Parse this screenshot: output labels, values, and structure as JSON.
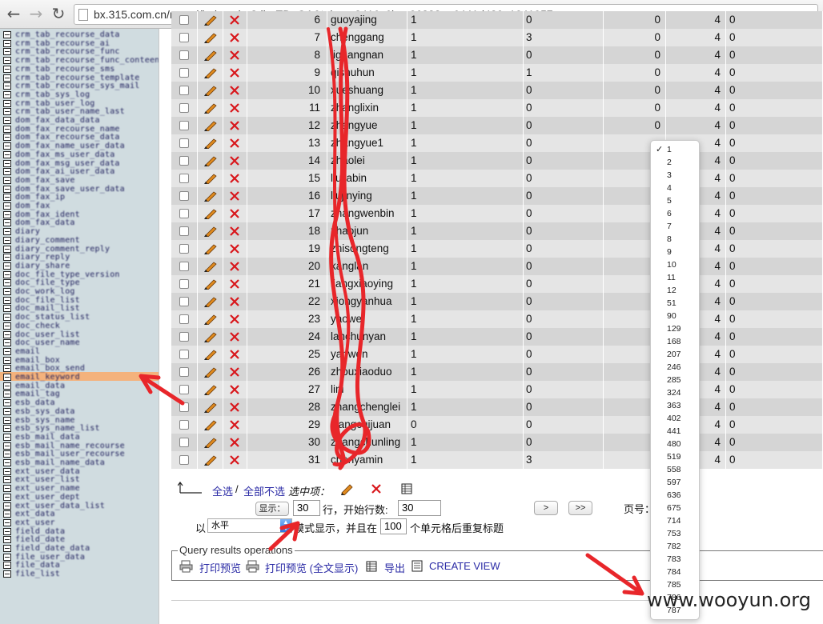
{
  "browser": {
    "url": "bx.315.com.cn/mysql/index.php?db=TD_OA&token=3416c6bca06323ea6441d429a1041957",
    "back_icon": "←",
    "forward_icon": "→",
    "reload_icon": "↻"
  },
  "sidebar": {
    "items": [
      "crm_tab_recourse_data",
      "crm_tab_recourse_ai",
      "crm_tab_recourse_func",
      "crm_tab_recourse_func_conteent",
      "crm_tab_recourse_sms",
      "crm_tab_recourse_template",
      "crm_tab_recourse_sys_mail",
      "crm_tab_sys_log",
      "crm_tab_user_log",
      "crm_tab_user_name_last",
      "dom_fax_data_data",
      "dom_fax_recourse_name",
      "dom_fax_recourse_data",
      "dom_fax_name_user_data",
      "dom_fax_ms_user_data",
      "dom_fax_msg_user_data",
      "dom_fax_ai_user_data",
      "dom_fax_save",
      "dom_fax_save_user_data",
      "dom_fax_ip",
      "dom_fax",
      "dom_fax_ident",
      "dom_fax_data",
      "diary",
      "diary_comment",
      "diary_comment_reply",
      "diary_reply",
      "diary_share",
      "doc_file_type_version",
      "doc_file_type",
      "doc_work_log",
      "doc_file_list",
      "doc_mail_list",
      "doc_status_list",
      "doc_check",
      "doc_user_list",
      "doc_user_name",
      "email",
      "email_box",
      "email_box_send",
      "email_keyword",
      "email_data",
      "email_tag",
      "esb_data",
      "esb_sys_data",
      "esb_sys_name",
      "esb_sys_name_list",
      "esb_mail_data",
      "esb_mail_name_recourse",
      "esb_mail_user_recourse",
      "esb_mail_name_data",
      "ext_user_data",
      "ext_user_list",
      "ext_user_name",
      "ext_user_dept",
      "ext_user_data_list",
      "ext_data",
      "ext_user",
      "field_data",
      "field_date",
      "field_date_data",
      "file_user_data",
      "file_data",
      "file_list"
    ],
    "highlight_index": 39
  },
  "table": {
    "rows": [
      {
        "id": "6",
        "name": "guoyajing",
        "a": "1",
        "b": "0",
        "c": "0",
        "d": "4",
        "e": "0"
      },
      {
        "id": "7",
        "name": "chenggang",
        "a": "1",
        "b": "3",
        "c": "0",
        "d": "4",
        "e": "0"
      },
      {
        "id": "8",
        "name": "liguangnan",
        "a": "1",
        "b": "0",
        "c": "0",
        "d": "4",
        "e": "0"
      },
      {
        "id": "9",
        "name": "qishuhun",
        "a": "1",
        "b": "1",
        "c": "0",
        "d": "4",
        "e": "0"
      },
      {
        "id": "10",
        "name": "xueshuang",
        "a": "1",
        "b": "0",
        "c": "0",
        "d": "4",
        "e": "0"
      },
      {
        "id": "11",
        "name": "zhanglixin",
        "a": "1",
        "b": "0",
        "c": "0",
        "d": "4",
        "e": "0"
      },
      {
        "id": "12",
        "name": "zhangyue",
        "a": "1",
        "b": "0",
        "c": "0",
        "d": "4",
        "e": "0"
      },
      {
        "id": "13",
        "name": "zhangyue1",
        "a": "1",
        "b": "0",
        "c": "",
        "d": "4",
        "e": "0"
      },
      {
        "id": "14",
        "name": "zhaolei",
        "a": "1",
        "b": "0",
        "c": "",
        "d": "4",
        "e": "0"
      },
      {
        "id": "15",
        "name": "liujiabin",
        "a": "1",
        "b": "0",
        "c": "",
        "d": "4",
        "e": "0"
      },
      {
        "id": "16",
        "name": "liujinying",
        "a": "1",
        "b": "0",
        "c": "",
        "d": "4",
        "e": "0"
      },
      {
        "id": "17",
        "name": "zhangwenbin",
        "a": "1",
        "b": "0",
        "c": "",
        "d": "4",
        "e": "0"
      },
      {
        "id": "18",
        "name": "zhaojun",
        "a": "1",
        "b": "0",
        "c": "",
        "d": "4",
        "e": "0"
      },
      {
        "id": "19",
        "name": "zhisongteng",
        "a": "1",
        "b": "0",
        "c": "",
        "d": "4",
        "e": "0"
      },
      {
        "id": "20",
        "name": "kanglan",
        "a": "1",
        "b": "0",
        "c": "",
        "d": "4",
        "e": "0"
      },
      {
        "id": "21",
        "name": "liangxiaoying",
        "a": "1",
        "b": "0",
        "c": "",
        "d": "4",
        "e": "0"
      },
      {
        "id": "22",
        "name": "xiongyanhua",
        "a": "1",
        "b": "0",
        "c": "",
        "d": "4",
        "e": "0"
      },
      {
        "id": "23",
        "name": "yaowei",
        "a": "1",
        "b": "0",
        "c": "",
        "d": "4",
        "e": "0"
      },
      {
        "id": "24",
        "name": "lanchunyan",
        "a": "1",
        "b": "0",
        "c": "",
        "d": "4",
        "e": "0"
      },
      {
        "id": "25",
        "name": "yanwen",
        "a": "1",
        "b": "0",
        "c": "",
        "d": "4",
        "e": "0"
      },
      {
        "id": "26",
        "name": "zhouxiaoduo",
        "a": "1",
        "b": "0",
        "c": "",
        "d": "4",
        "e": "0"
      },
      {
        "id": "27",
        "name": "lini",
        "a": "1",
        "b": "0",
        "c": "",
        "d": "4",
        "e": "0"
      },
      {
        "id": "28",
        "name": "zhangchenglei",
        "a": "1",
        "b": "0",
        "c": "",
        "d": "4",
        "e": "0"
      },
      {
        "id": "29",
        "name": "wangcuijuan",
        "a": "0",
        "b": "0",
        "c": "",
        "d": "4",
        "e": "0"
      },
      {
        "id": "30",
        "name": "zhangchunling",
        "a": "1",
        "b": "0",
        "c": "",
        "d": "4",
        "e": "0"
      },
      {
        "id": "31",
        "name": "chenyamin",
        "a": "1",
        "b": "3",
        "c": "",
        "d": "4",
        "e": "0"
      }
    ]
  },
  "controls": {
    "select_all": "全选",
    "separator": "/",
    "deselect_all": "全部不选",
    "with_selected": "选中项：",
    "show_label": "显示：",
    "rows_value": "30",
    "rows_text": "行，开始行数:",
    "start_value": "30",
    "next_button": ">",
    "last_button": ">>",
    "page_label": "页号：",
    "by_label": "以",
    "mode_value": "水平",
    "mode_text": "模式显示，并且在",
    "repeat_value": "100",
    "repeat_text": "个单元格后重复标题"
  },
  "query_ops": {
    "legend": "Query results operations",
    "print_preview": "打印预览",
    "print_preview_full": "打印预览 (全文显示)",
    "export": "导出",
    "create_view": "CREATE VIEW"
  },
  "page_dropdown": {
    "options": [
      "1",
      "2",
      "3",
      "4",
      "5",
      "6",
      "7",
      "8",
      "9",
      "10",
      "11",
      "12",
      "51",
      "90",
      "129",
      "168",
      "207",
      "246",
      "285",
      "324",
      "363",
      "402",
      "441",
      "480",
      "519",
      "558",
      "597",
      "636",
      "675",
      "714",
      "753",
      "782",
      "783",
      "784",
      "785",
      "786",
      "787"
    ],
    "selected": "1"
  },
  "watermark": "www.wooyun.org",
  "colors": {
    "annotation_red": "#e8262a",
    "highlight": "#f4b27c",
    "link": "#2a2aa5"
  }
}
